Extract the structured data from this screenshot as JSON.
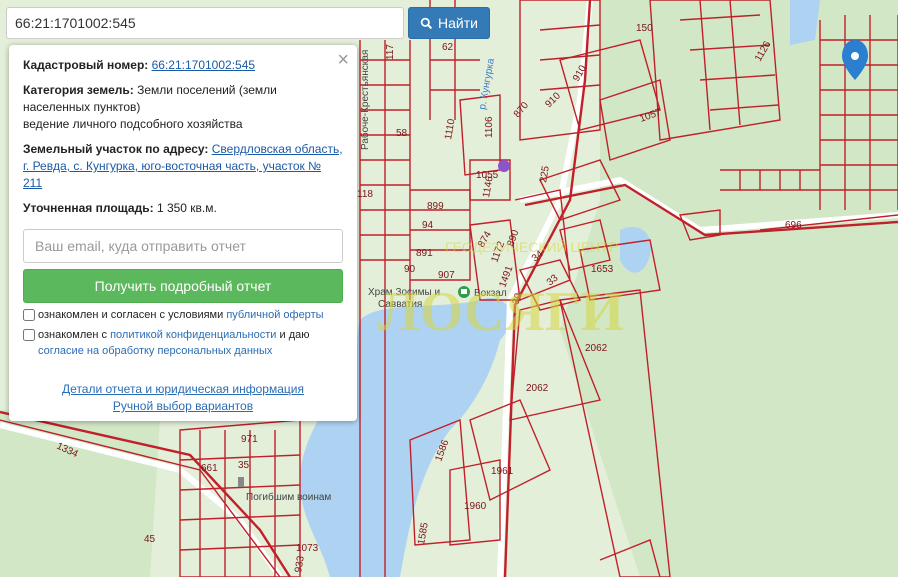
{
  "search": {
    "value": "66:21:1701002:545",
    "button_label": "Найти"
  },
  "panel": {
    "cadastral_label": "Кадастровый номер:",
    "cadastral_value": "66:21:1701002:545",
    "category_label": "Категория земель:",
    "category_value": "Земли поселений (земли населенных пунктов)",
    "usage": "ведение личного подсобного хозяйства",
    "address_label": "Земельный участок по адресу:",
    "address_value": "Свердловская область, г. Ревда, с. Кунгурка, юго-восточная часть, участок № 211",
    "area_label": "Уточненная площадь:",
    "area_value": "1 350 кв.м.",
    "email_placeholder": "Ваш email, куда отправить отчет",
    "submit_label": "Получить подробный отчет",
    "consent1_text": "ознакомлен и согласен с условиями",
    "consent1_link": "публичной оферты",
    "consent2_text": "ознакомлен с",
    "consent2_link1": "политикой конфиденциальности",
    "consent2_mid": "и даю",
    "consent2_link2": "согласие на обработку персональных данных",
    "details_link": "Детали отчета и юридическая информация",
    "manual_link": "Ручной выбор вариантов",
    "close_icon": "×"
  },
  "map": {
    "colors": {
      "land": "#e3efd9",
      "forest": "#cfe6c2",
      "water": "#aed3f2",
      "parcel": "#c0202a",
      "road": "#ffffff",
      "text": "#7a1418",
      "watermark": "#d6d640",
      "pin": "#2a7fd0"
    },
    "parcel_labels": [
      "150",
      "1126",
      "62",
      "117",
      "58",
      "910",
      "870",
      "1057",
      "1110",
      "1106",
      "1055",
      "225",
      "118",
      "899",
      "94",
      "1146",
      "891",
      "874",
      "1172",
      "890",
      "907",
      "90",
      "1491",
      "34",
      "1653",
      "33",
      "39",
      "696",
      "2062",
      "2062",
      "1586",
      "1961",
      "1960",
      "1585",
      "1334",
      "661",
      "35",
      "971",
      "1073",
      "933",
      "45"
    ],
    "place_labels": [
      "Рабоче-Крестьянская",
      "р. Кунгурка",
      "Храм Зосимы и Савватия",
      "Вокзал",
      "Погибшим воинам"
    ],
    "watermark": "ЛОСЯГИ",
    "watermark_sub": "ГЕОДЕЗИЧЕСКИЙ ЦЕНТР",
    "icons": [
      "map-pin-icon",
      "church-icon",
      "bus-icon",
      "monument-icon"
    ]
  }
}
